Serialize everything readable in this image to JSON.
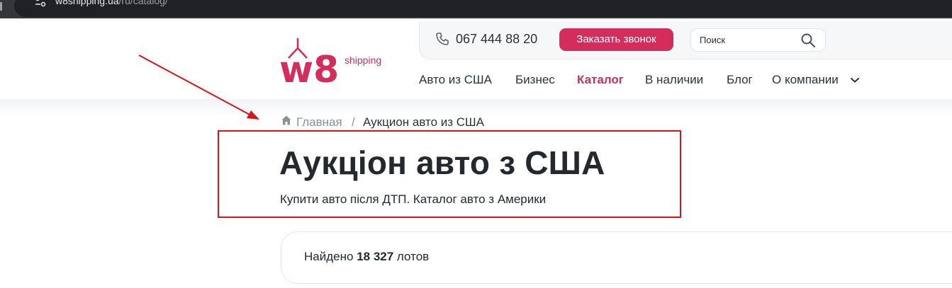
{
  "browser": {
    "url_host": "w8shipping.ua",
    "url_path": "/ru/catalog/"
  },
  "header": {
    "logo_text": "w8",
    "logo_tagline": "shipping",
    "phone": "067 444 88 20",
    "call_button": "Заказать звонок",
    "search_placeholder": "Поиск",
    "nav": [
      {
        "label": "Авто из США",
        "active": false
      },
      {
        "label": "Бизнес",
        "active": false
      },
      {
        "label": "Каталог",
        "active": true
      },
      {
        "label": "В наличии",
        "active": false
      },
      {
        "label": "Блог",
        "active": false
      },
      {
        "label": "О компании",
        "active": false
      }
    ]
  },
  "breadcrumb": {
    "home": "Главная",
    "separator": "/",
    "current": "Аукцион авто из США"
  },
  "main": {
    "title": "Аукціон авто з США",
    "subtitle": "Купити авто після ДТП. Каталог авто з Америки",
    "results_prefix": "Найдено",
    "results_count": "18 327",
    "results_suffix": "лотов"
  },
  "colors": {
    "brand": "#d42c5b",
    "annotation": "#d7141a",
    "text": "#23292e"
  },
  "icons": [
    "tune-icon",
    "phone-icon",
    "search-icon",
    "chevron-down-icon",
    "home-icon",
    "arrow-annotation"
  ]
}
